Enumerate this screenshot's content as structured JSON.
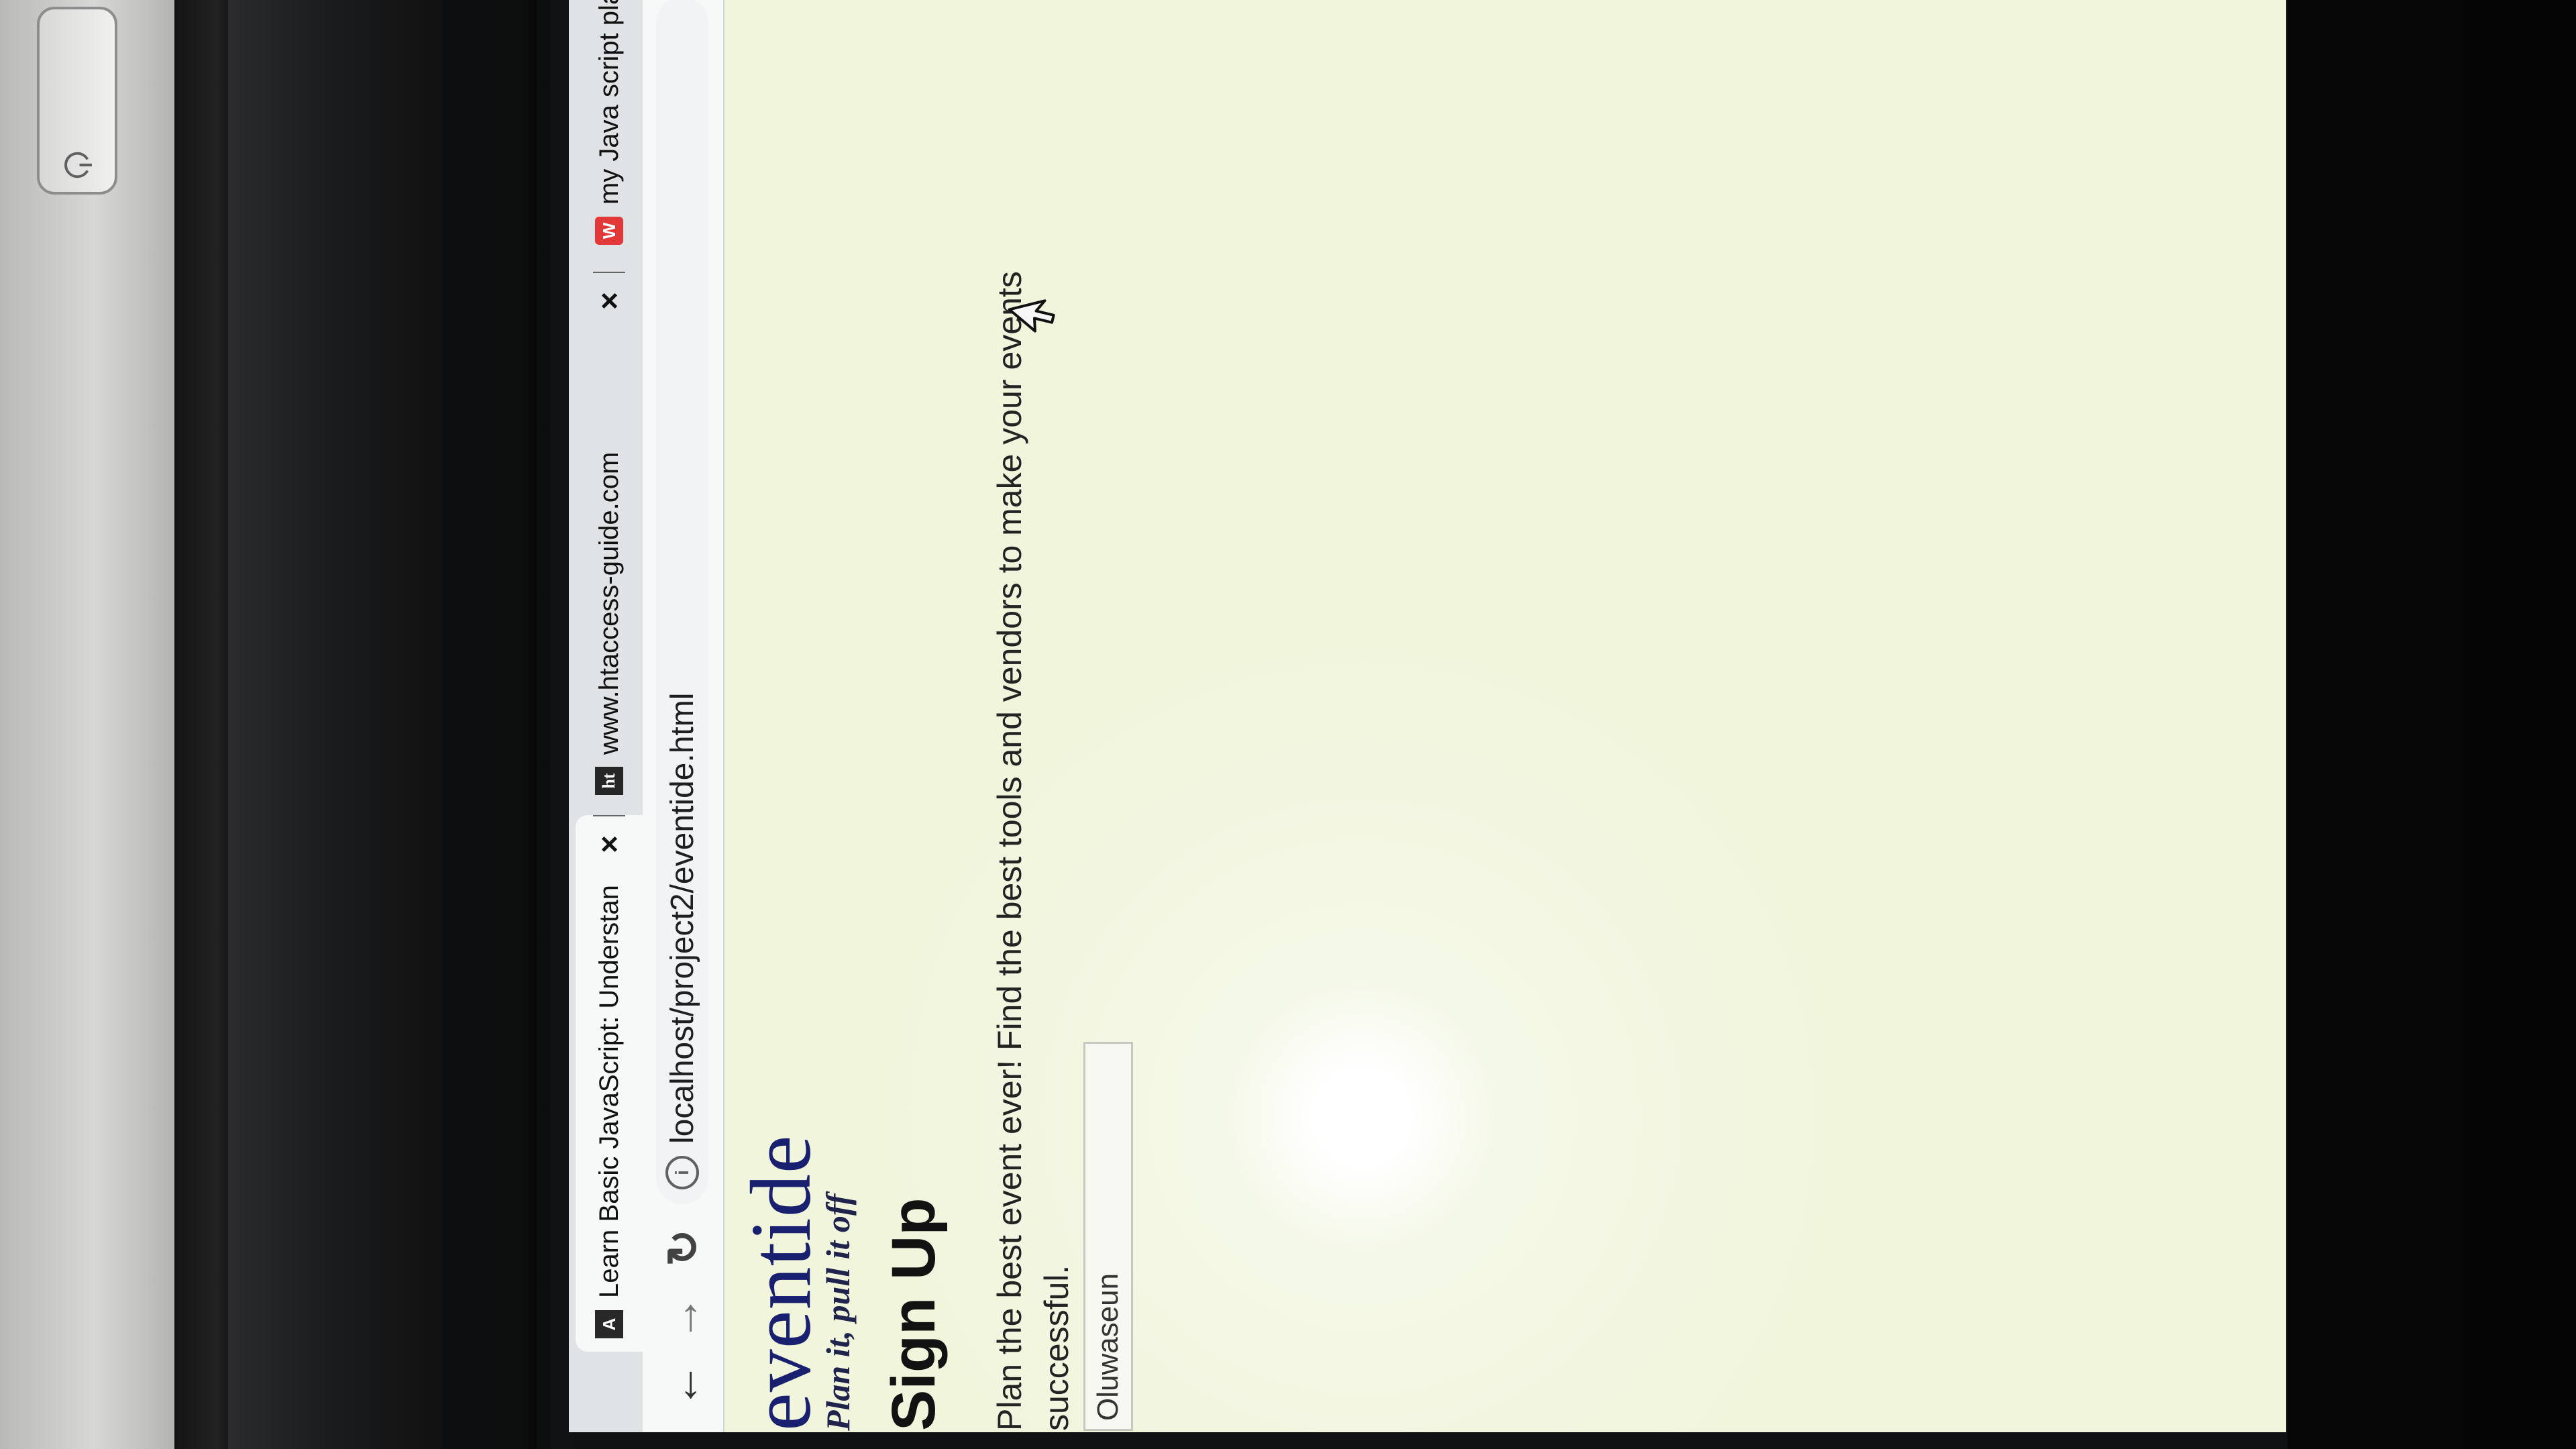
{
  "browser": {
    "tabs": [
      {
        "label": "Learn Basic JavaScript: Understan",
        "favicon_text": "A"
      },
      {
        "label": "www.htaccess-guide.com",
        "favicon_text": "ht"
      },
      {
        "label": "my Java script play gro",
        "favicon_text": "W"
      }
    ],
    "address": "localhost/project2/eventide.html"
  },
  "page": {
    "brand": "eventide",
    "tagline": "Plan it, pull it off",
    "heading": "Sign Up",
    "description": "Plan the best event ever! Find the best tools and vendors to make your events successful.",
    "name_input_value": "Oluwaseun"
  },
  "colors": {
    "page_background": "#f3f7df",
    "brand": "#18206f",
    "text": "#232323"
  },
  "icons": {
    "back": "arrow-left-icon",
    "forward": "arrow-right-icon",
    "reload": "refresh-icon",
    "info": "info-icon",
    "close": "close-icon",
    "cursor": "pointer-icon",
    "power": "power-icon"
  }
}
